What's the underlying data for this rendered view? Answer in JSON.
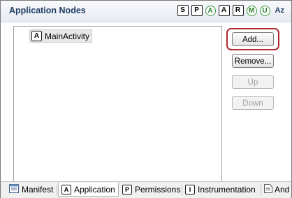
{
  "section": {
    "title": "Application Nodes"
  },
  "filters": [
    {
      "label": "S",
      "shape": "box"
    },
    {
      "label": "P",
      "shape": "box"
    },
    {
      "label": "A",
      "shape": "circle"
    },
    {
      "label": "A",
      "shape": "box"
    },
    {
      "label": "R",
      "shape": "box"
    },
    {
      "label": "M",
      "shape": "circle"
    },
    {
      "label": "U",
      "shape": "circle"
    },
    {
      "label": "Az",
      "shape": "text"
    }
  ],
  "tree": {
    "nodes": [
      {
        "icon_letter": "A",
        "label": "MainActivity"
      }
    ]
  },
  "buttons": {
    "add": "Add...",
    "remove": "Remove...",
    "up": "Up",
    "down": "Down"
  },
  "tabs": [
    {
      "label": "Manifest",
      "icon": "manifest-icon",
      "active": false
    },
    {
      "label": "Application",
      "icon_letter": "A",
      "active": true
    },
    {
      "label": "Permissions",
      "icon_letter": "P",
      "active": false
    },
    {
      "label": "Instrumentation",
      "icon_letter": "I",
      "active": false
    },
    {
      "label": "And",
      "icon": "xml-file-icon",
      "active": false
    }
  ],
  "colors": {
    "title": "#1f3b63",
    "highlight": "#b02a30",
    "filter_green": "#3a9a3a"
  }
}
